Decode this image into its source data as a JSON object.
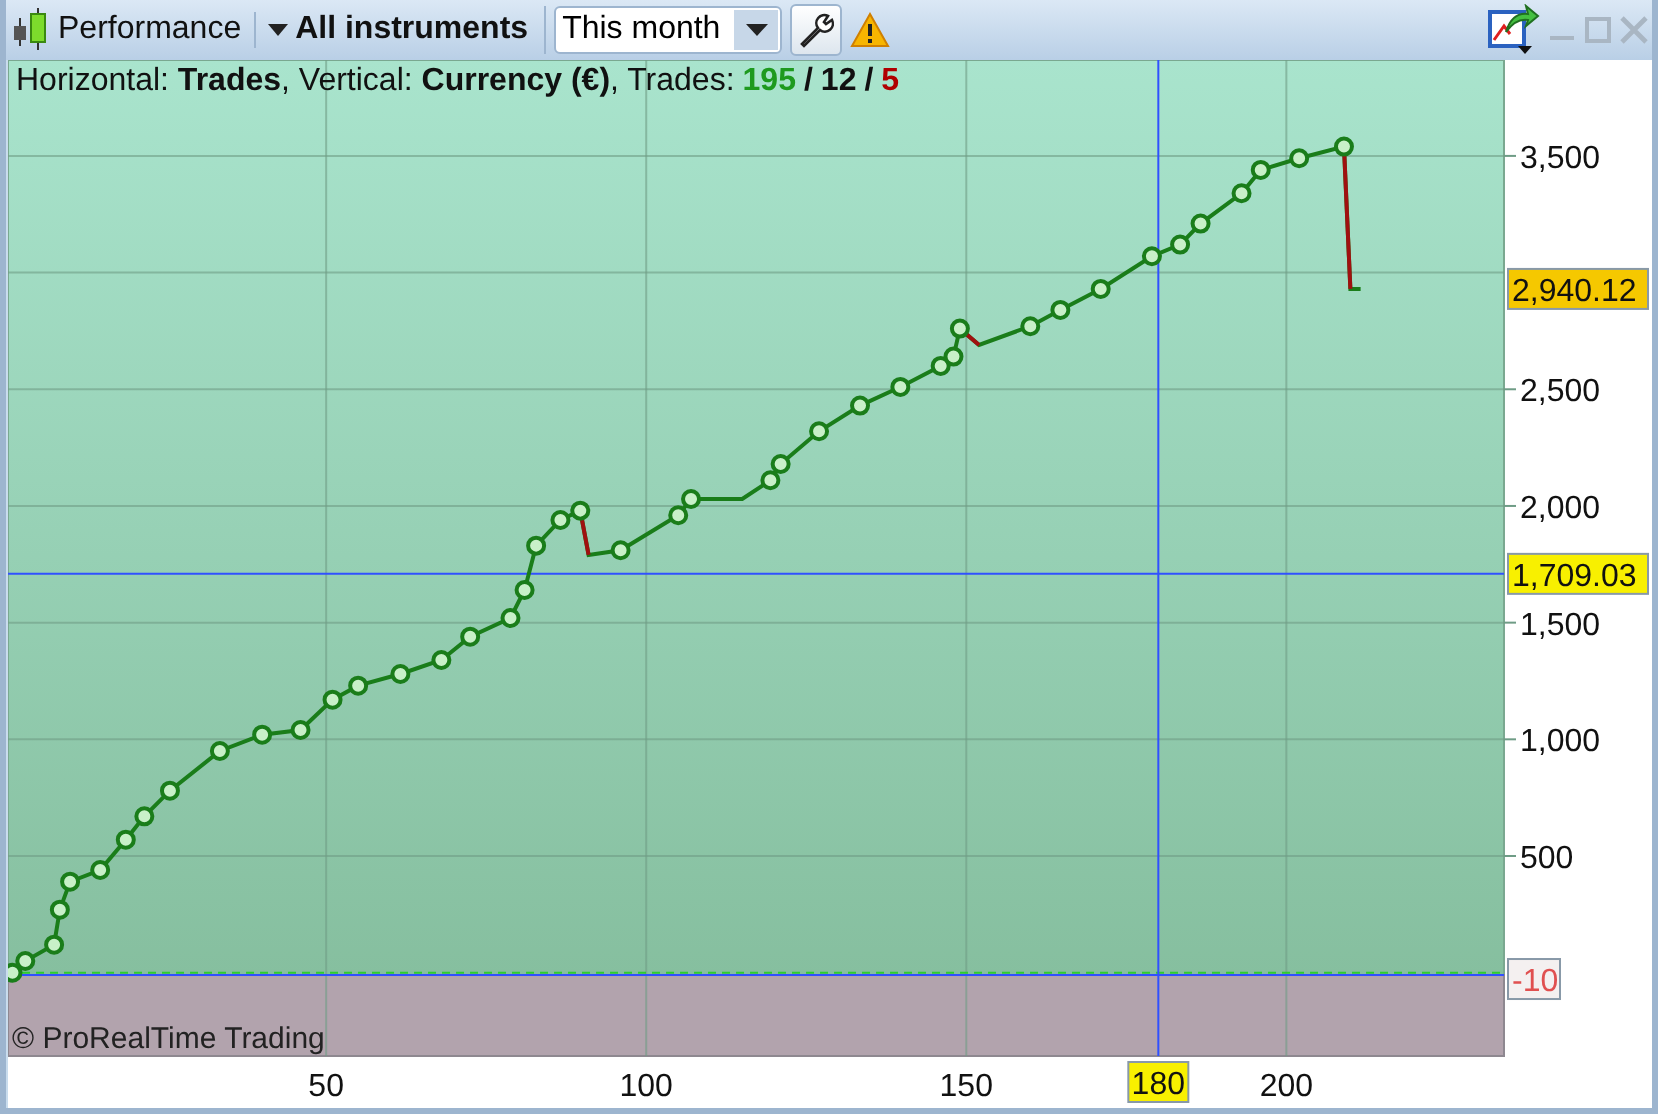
{
  "toolbar": {
    "title": "Performance",
    "instruments": "All instruments",
    "period": "This month"
  },
  "info": {
    "text": "Horizontal: **Trades**, Vertical: **Currency (€)**, Trades:",
    "separator": "/",
    "counts": [
      {
        "value": "195",
        "color": "#1e9a1e"
      },
      {
        "value": "12",
        "color": "#111111"
      },
      {
        "value": "5",
        "color": "#b00000"
      }
    ]
  },
  "chart": {
    "watermark": "© ProRealTime Trading",
    "chart_data": {
      "type": "line",
      "grid": true,
      "xlim": [
        0.3,
        234
      ],
      "ylim": [
        -357,
        3911
      ],
      "xticks": [
        50,
        100,
        150,
        200
      ],
      "yticks": [
        {
          "value": 500,
          "label": "500"
        },
        {
          "value": 1000,
          "label": "1,000"
        },
        {
          "value": 1500,
          "label": "1,500"
        },
        {
          "value": 2000,
          "label": "2,000"
        },
        {
          "value": 2500,
          "label": "2,500"
        },
        {
          "value": 3500,
          "label": "3,500"
        }
      ],
      "ref_lines": [
        {
          "axis": "y",
          "value": 0,
          "color": "#2ecc2e"
        },
        {
          "axis": "y",
          "value": -10,
          "color": "#3050ff",
          "label": "-10"
        },
        {
          "axis": "y",
          "value": 1709.03,
          "color": "#3050ff",
          "label": "1,709.03"
        },
        {
          "axis": "x",
          "value": 180,
          "color": "#3050ff",
          "label": "180"
        }
      ],
      "annotations": [
        "2,940.12"
      ],
      "x": [
        1,
        3,
        7.5,
        8.4,
        10,
        14.7,
        18.7,
        21.6,
        25.6,
        33.4,
        40,
        46,
        51,
        55,
        61.6,
        68,
        72.5,
        78.8,
        81,
        82.8,
        86.6,
        89.7,
        91,
        96,
        105,
        107,
        115,
        119.4,
        121,
        127,
        133.4,
        139.7,
        146,
        148,
        149,
        152,
        160,
        164.7,
        171,
        179,
        183.4,
        186.6,
        193,
        196,
        202,
        209,
        210,
        211.6
      ],
      "series": [
        {
          "color": "#1a7d1a",
          "marker": "o",
          "values": [
            0,
            50,
            120,
            270,
            390,
            440,
            570,
            670,
            780,
            950,
            1020,
            1040,
            1170,
            1230,
            1280,
            1340,
            1440,
            1520,
            1640,
            1830,
            1940,
            1980,
            1790,
            1810,
            1960,
            2030,
            2030,
            2110,
            2180,
            2320,
            2430,
            2510,
            2600,
            2640,
            2760,
            2690,
            2770,
            2840,
            2930,
            3070,
            3120,
            3210,
            3340,
            3440,
            3490,
            3540,
            2930,
            2930
          ]
        }
      ]
    }
  }
}
